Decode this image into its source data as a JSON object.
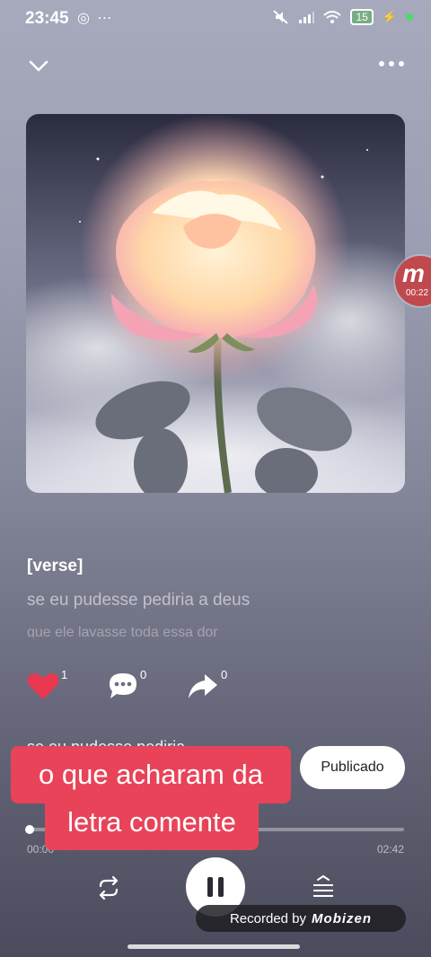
{
  "status_bar": {
    "time": "23:45",
    "left_icons": [
      "whatsapp-icon",
      "more-dots-icon"
    ],
    "right_icons": [
      "mute-icon",
      "signal-icon",
      "wifi-icon"
    ],
    "battery": "15"
  },
  "top_bar": {
    "collapse_icon": "chevron-down-icon",
    "more_icon": "more-horizontal-icon"
  },
  "recorder_bubble": {
    "logo": "m",
    "timer": "00:22"
  },
  "lyrics": {
    "tag": "[verse]",
    "line_current": "se eu pudesse pediria a deus",
    "line_next": "que ele lavasse toda essa dor"
  },
  "actions": {
    "like_count": "1",
    "comment_count": "0",
    "share_count": "0"
  },
  "song": {
    "title": "se eu pudesse pediria",
    "publish_label": "Publicado"
  },
  "caption": {
    "line1": "o que acharam da",
    "line2": "letra comente"
  },
  "progress": {
    "current": "00:00",
    "total": "02:42",
    "fraction": 0.01
  },
  "recorder": {
    "label": "Recorded by",
    "brand": "Mobizen"
  },
  "colors": {
    "accent_red": "#e84359",
    "heart": "#e8384f"
  }
}
